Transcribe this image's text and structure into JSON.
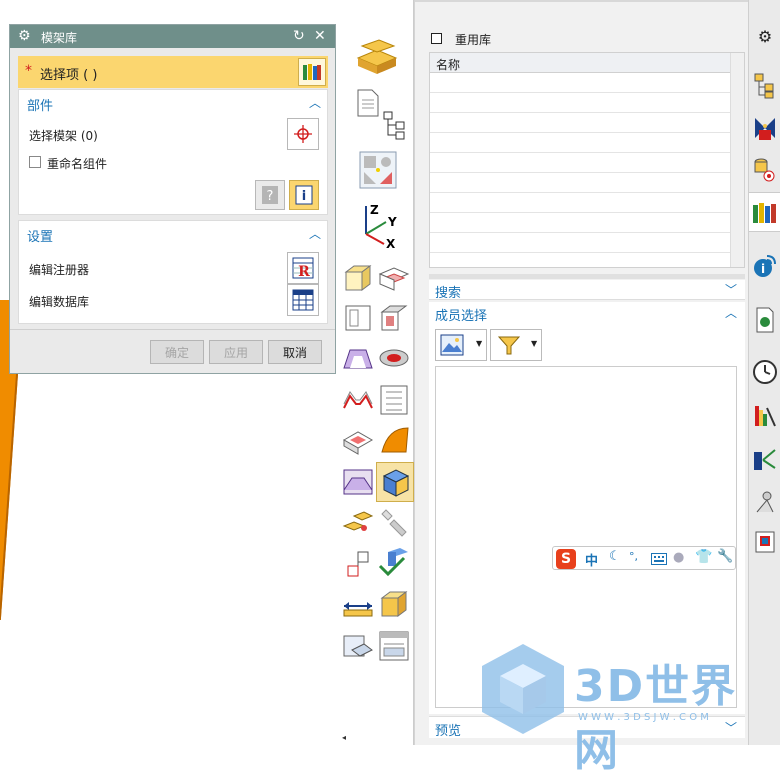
{
  "dialog": {
    "title": "模架库",
    "selection_required_marker": "*",
    "selection_label": "选择项 ( )",
    "part_section": {
      "title": "部件",
      "select_mold_label": "选择模架 (0)",
      "rename_label": "重命名组件"
    },
    "settings_section": {
      "title": "设置",
      "edit_register_label": "编辑注册器",
      "edit_database_label": "编辑数据库"
    },
    "buttons": {
      "ok": "确定",
      "apply": "应用",
      "cancel": "取消"
    }
  },
  "reuse_library": {
    "title": "重用库",
    "column_name": "名称",
    "search_label": "搜索",
    "member_select_label": "成员选择",
    "preview_label": "预览"
  },
  "ime": {
    "lang": "中",
    "punct": "°,"
  },
  "watermark": {
    "brand": "3D世界网",
    "url": "W W W . 3 D S J W . C O M"
  },
  "colors": {
    "accent_blue": "#1b74b6",
    "title_bar": "#6f8f8a",
    "orange": "#f08c00",
    "highlight": "#fbd66f"
  }
}
